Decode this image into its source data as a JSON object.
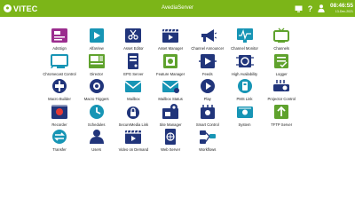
{
  "header": {
    "logo_text": "VITEC",
    "app_title": "AvediaServer",
    "time": "08:46:55",
    "date": "13-Dec-2021",
    "icons": [
      "monitor-icon",
      "help-icon",
      "user-icon"
    ]
  },
  "colors": {
    "brand_green": "#7cb518",
    "tile_purple": "#9b2d8e",
    "tile_teal": "#1795b5",
    "tile_green": "#5fa22d",
    "tile_navy": "#21357b"
  },
  "apps": [
    {
      "label": "AdsSign",
      "icon": "ads-sign-icon"
    },
    {
      "label": "AlfaView",
      "icon": "alfaview-icon"
    },
    {
      "label": "Asset Editor",
      "icon": "asset-editor-icon"
    },
    {
      "label": "Asset Manager",
      "icon": "asset-manager-icon"
    },
    {
      "label": "Channel Announcer",
      "icon": "megaphone-icon"
    },
    {
      "label": "Channel Monitor",
      "icon": "channel-monitor-icon"
    },
    {
      "label": "Channels",
      "icon": "tv-icon"
    },
    {
      "label": "Chromecast Control",
      "icon": "chromecast-icon"
    },
    {
      "label": "Director",
      "icon": "director-icon"
    },
    {
      "label": "EPG Server",
      "icon": "epg-server-icon"
    },
    {
      "label": "Feature Manager",
      "icon": "feature-manager-icon"
    },
    {
      "label": "Feeds",
      "icon": "feeds-icon"
    },
    {
      "label": "High Availability",
      "icon": "high-availability-icon"
    },
    {
      "label": "Logger",
      "icon": "logger-icon"
    },
    {
      "label": "Macro Builder",
      "icon": "macro-builder-icon"
    },
    {
      "label": "Macro Triggers",
      "icon": "macro-triggers-icon"
    },
    {
      "label": "Mailbox",
      "icon": "mailbox-icon"
    },
    {
      "label": "Mailbox Status",
      "icon": "mailbox-status-icon"
    },
    {
      "label": "Play",
      "icon": "play-icon"
    },
    {
      "label": "PMS Link",
      "icon": "pms-link-icon"
    },
    {
      "label": "Projector Control",
      "icon": "projector-control-icon"
    },
    {
      "label": "Recorder",
      "icon": "recorder-icon"
    },
    {
      "label": "Schedules",
      "icon": "schedules-icon"
    },
    {
      "label": "SecureMedia Link",
      "icon": "secure-media-link-icon"
    },
    {
      "label": "Site Manager",
      "icon": "site-manager-icon"
    },
    {
      "label": "Smart Control",
      "icon": "smart-control-icon"
    },
    {
      "label": "System",
      "icon": "system-icon"
    },
    {
      "label": "TFTP Server",
      "icon": "tftp-server-icon"
    },
    {
      "label": "Transfer",
      "icon": "transfer-icon"
    },
    {
      "label": "Users",
      "icon": "users-icon"
    },
    {
      "label": "Video on Demand",
      "icon": "video-on-demand-icon"
    },
    {
      "label": "Web Server",
      "icon": "web-server-icon"
    },
    {
      "label": "Workflows",
      "icon": "workflows-icon"
    }
  ]
}
